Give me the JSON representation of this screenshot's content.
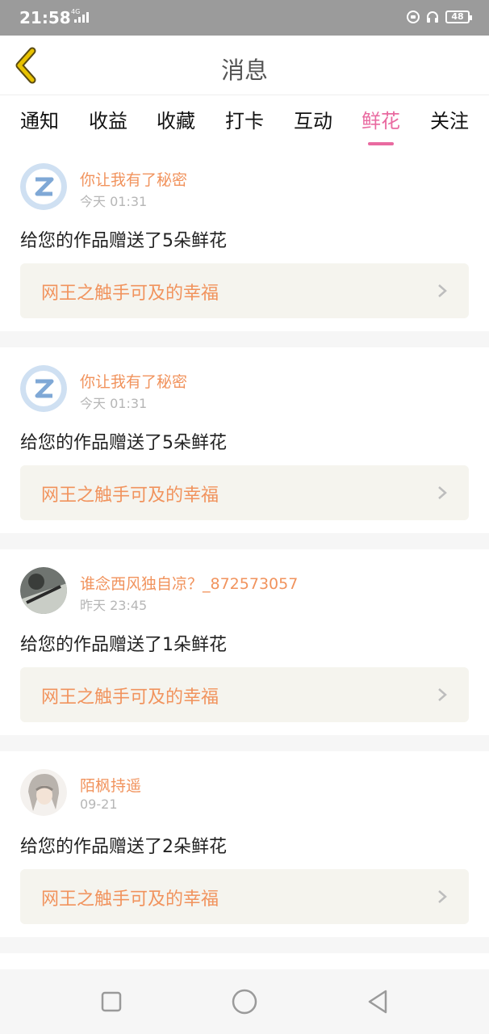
{
  "status": {
    "time": "21:58",
    "network": "4G",
    "battery": "48"
  },
  "header": {
    "title": "消息"
  },
  "tabs": [
    {
      "label": "通知"
    },
    {
      "label": "收益"
    },
    {
      "label": "收藏"
    },
    {
      "label": "打卡"
    },
    {
      "label": "互动"
    },
    {
      "label": "鲜花",
      "active": true
    },
    {
      "label": "关注"
    }
  ],
  "messages": [
    {
      "user": "你让我有了秘密",
      "time": "今天 01:31",
      "text": "给您的作品赠送了5朵鲜花",
      "work": "网王之触手可及的幸福",
      "avatar": "default-avatar"
    },
    {
      "user": "你让我有了秘密",
      "time": "今天 01:31",
      "text": "给您的作品赠送了5朵鲜花",
      "work": "网王之触手可及的幸福",
      "avatar": "default-avatar"
    },
    {
      "user": "谁念西风独自凉？_872573057",
      "time": "昨天 23:45",
      "text": "给您的作品赠送了1朵鲜花",
      "work": "网王之触手可及的幸福",
      "avatar": "photo-avatar"
    },
    {
      "user": "陌枫持遥",
      "time": "09-21",
      "text": "给您的作品赠送了2朵鲜花",
      "work": "网王之触手可及的幸福",
      "avatar": "anime-avatar"
    }
  ],
  "colors": {
    "accent": "#e96aa0",
    "name": "#f1935d",
    "card": "#f5f4ee",
    "back": "#e8c200"
  }
}
